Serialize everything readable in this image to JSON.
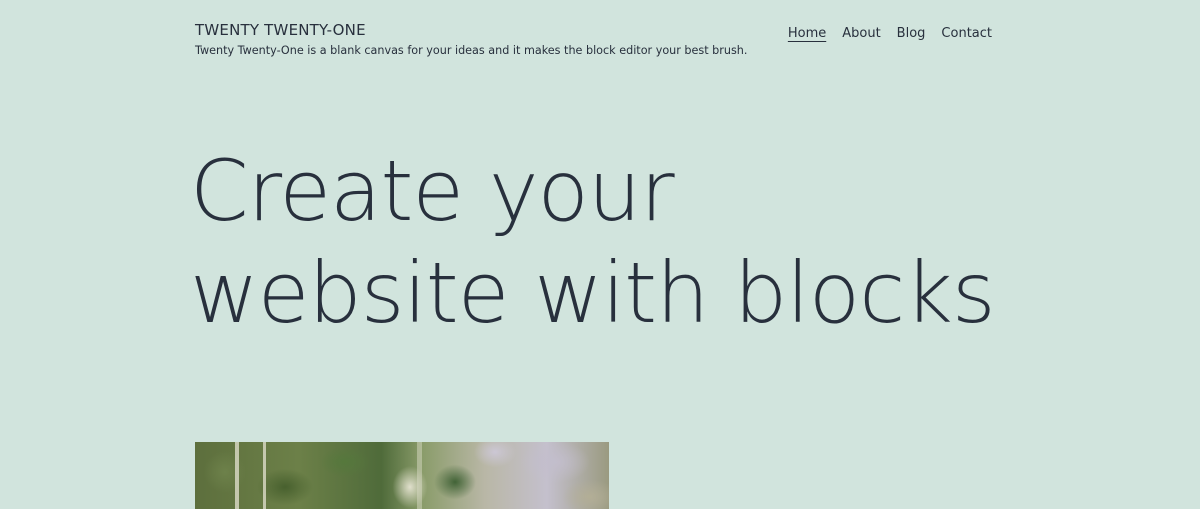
{
  "header": {
    "site_title": "TWENTY TWENTY-ONE",
    "site_description": "Twenty Twenty-One is a blank canvas for your ideas and it makes the block editor your best brush."
  },
  "nav": {
    "items": [
      {
        "label": "Home",
        "current": true
      },
      {
        "label": "About",
        "current": false
      },
      {
        "label": "Blog",
        "current": false
      },
      {
        "label": "Contact",
        "current": false
      }
    ]
  },
  "main": {
    "heading": "Create your website with blocks"
  },
  "colors": {
    "background": "#d1e4dd",
    "text": "#28303d"
  }
}
